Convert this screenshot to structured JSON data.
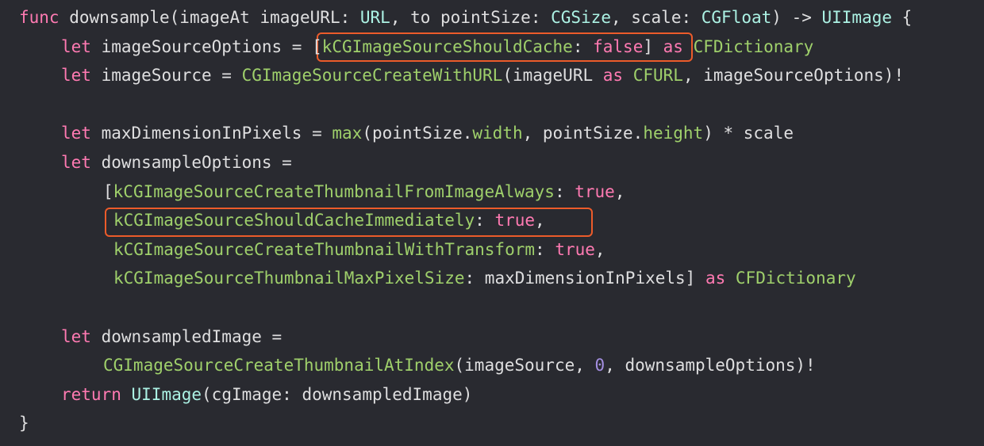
{
  "code": {
    "line1": {
      "kw_func": "func",
      "name": " downsample(imageAt imageURL: ",
      "type_url": "URL",
      "p2": ", to pointSize: ",
      "type_cgsize": "CGSize",
      "p3": ", scale: ",
      "type_cgfloat": "CGFloat",
      "p4": ") -> ",
      "type_uiimage": "UIImage",
      "p5": " {"
    },
    "line2": {
      "kw_let": "let",
      "p1": " imageSourceOptions = ",
      "bracket_open": "[",
      "key": "kCGImageSourceShouldCache",
      "colon": ": ",
      "val_false": "false",
      "bracket_close": "]",
      "p_space": " ",
      "kw_as": "as",
      "p_space2": " ",
      "type_cfdict": "CFDictionary"
    },
    "line3": {
      "kw_let": "let",
      "p1": " imageSource = ",
      "func_create": "CGImageSourceCreateWithURL",
      "p2": "(imageURL ",
      "kw_as": "as",
      "p3": " ",
      "type_cfurl": "CFURL",
      "p4": ", imageSourceOptions)!"
    },
    "line5": {
      "kw_let": "let",
      "p1": " maxDimensionInPixels = ",
      "func_max": "max",
      "p2": "(pointSize.",
      "prop_width": "width",
      "p3": ", pointSize.",
      "prop_height": "height",
      "p4": ") * scale"
    },
    "line6": {
      "kw_let": "let",
      "p1": " downsampleOptions ="
    },
    "line7": {
      "bracket_open": "[",
      "key": "kCGImageSourceCreateThumbnailFromImageAlways",
      "colon": ": ",
      "val_true": "true",
      "comma": ","
    },
    "line8": {
      "key": "kCGImageSourceShouldCacheImmediately",
      "colon": ": ",
      "val_true": "true",
      "comma": ","
    },
    "line9": {
      "key": "kCGImageSourceCreateThumbnailWithTransform",
      "colon": ": ",
      "val_true": "true",
      "comma": ","
    },
    "line10": {
      "key": "kCGImageSourceThumbnailMaxPixelSize",
      "p1": ": maxDimensionInPixels] ",
      "kw_as": "as",
      "p2": " ",
      "type_cfdict": "CFDictionary"
    },
    "line12": {
      "kw_let": "let",
      "p1": " downsampledImage ="
    },
    "line13": {
      "func_thumb": "CGImageSourceCreateThumbnailAtIndex",
      "p1": "(imageSource, ",
      "num_zero": "0",
      "p2": ", downsampleOptions)!"
    },
    "line14": {
      "kw_return": "return",
      "p1": " ",
      "type_uiimage": "UIImage",
      "p2": "(cgImage: downsampledImage)"
    },
    "line15": {
      "brace": "}"
    }
  },
  "colors": {
    "background": "#292a30",
    "keyword": "#ff7ab2",
    "type": "#acf2e4",
    "project_symbol": "#9fd06b",
    "plain": "#dfdfe0",
    "number": "#a38ee0",
    "highlight_border": "#ec5b2a"
  }
}
